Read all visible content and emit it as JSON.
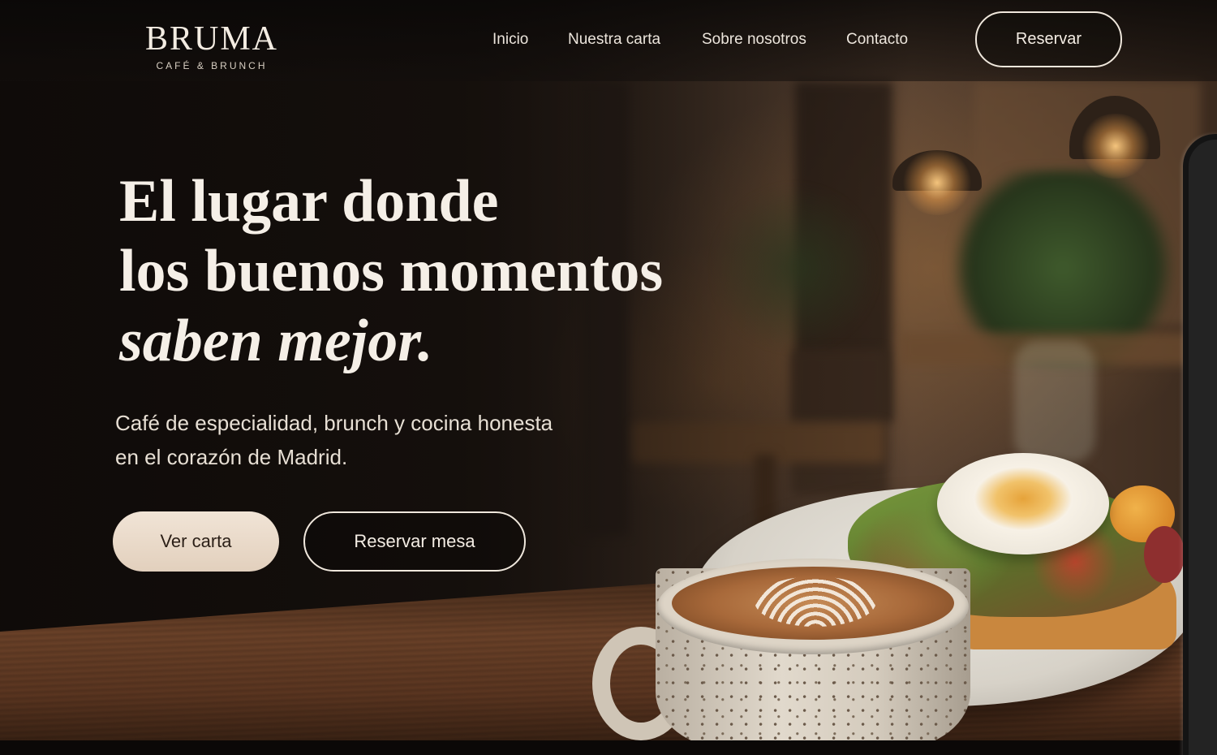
{
  "brand": {
    "name": "BRUMA",
    "tagline": "CAFÉ & BRUNCH"
  },
  "nav": {
    "items": [
      {
        "label": "Inicio"
      },
      {
        "label": "Nuestra carta"
      },
      {
        "label": "Sobre nosotros"
      },
      {
        "label": "Contacto"
      }
    ],
    "cta_label": "Reservar"
  },
  "hero": {
    "title_line1": "El lugar donde",
    "title_line2": "los buenos momentos",
    "title_line3": "saben mejor.",
    "subtitle_line1": "Café de especialidad, brunch y cocina honesta",
    "subtitle_line2": "en el corazón de Madrid.",
    "primary_button": "Ver carta",
    "secondary_button": "Reservar mesa"
  },
  "colors": {
    "accent_button": "#e9d9c8",
    "text_light": "#f5efe7",
    "background_dark": "#1a1411"
  },
  "icons": [
    "latte-cup-photo",
    "brunch-plate-photo"
  ]
}
